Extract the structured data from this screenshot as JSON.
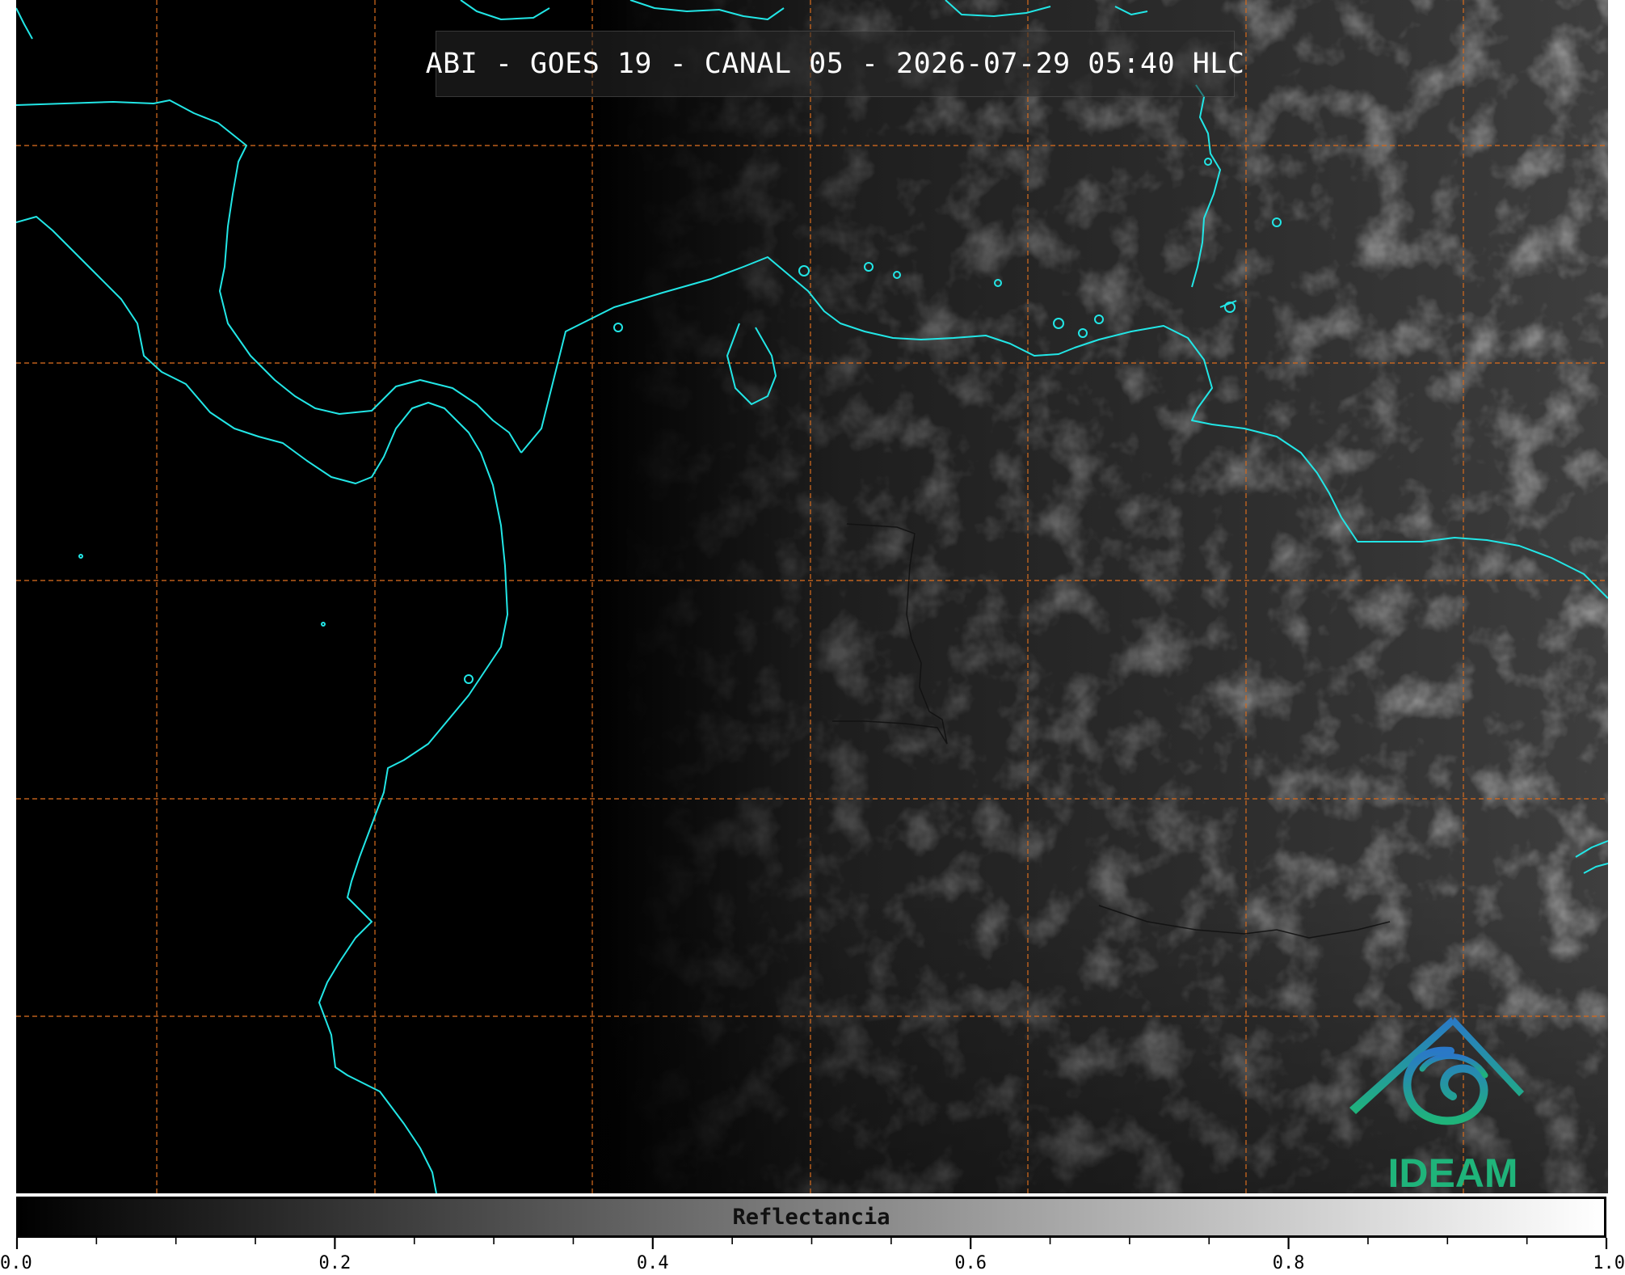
{
  "title": "ABI - GOES 19 - CANAL 05 - 2026-07-29 05:40 HLC",
  "colorbar": {
    "label": "Reflectancia",
    "min": 0.0,
    "max": 1.0,
    "tick_labels": [
      "0.0",
      "0.2",
      "0.4",
      "0.6",
      "0.8",
      "1.0"
    ],
    "tick_values": [
      0.0,
      0.2,
      0.4,
      0.6,
      0.8,
      1.0
    ],
    "minor_step": 0.05,
    "colormap": [
      "#000000",
      "#ffffff"
    ]
  },
  "logo": {
    "text": "IDEAM",
    "color_top": "#2a78c8",
    "color_bottom": "#1fb47a"
  },
  "map": {
    "coastline_color": "#22e6e6",
    "grid_color": "#d2691e",
    "grid_style": "dashed",
    "background": "#000000",
    "imagery": "reflectance"
  }
}
